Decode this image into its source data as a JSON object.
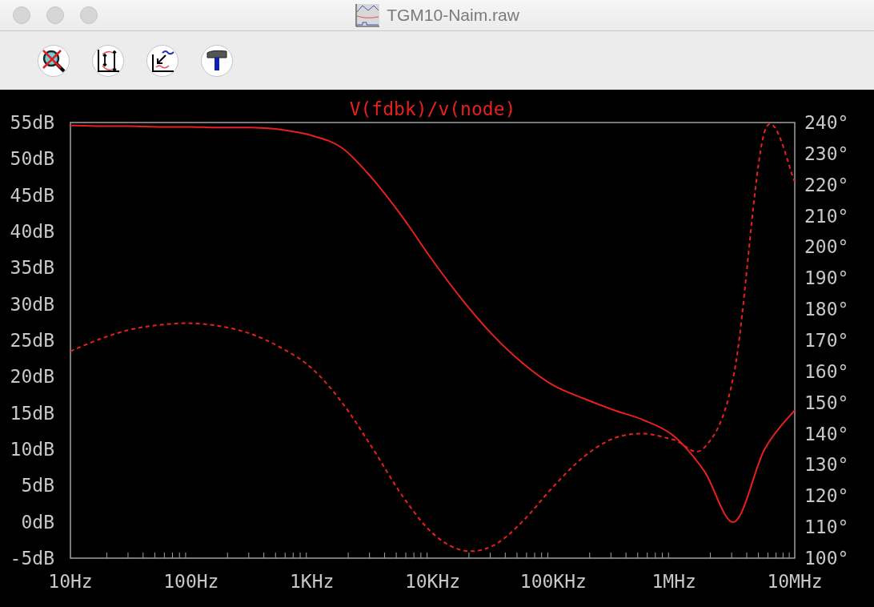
{
  "window": {
    "title": "TGM10-Naim.raw"
  },
  "toolbar": {
    "buttons": [
      {
        "kind": "zoom-cancel"
      },
      {
        "kind": "autorange"
      },
      {
        "kind": "back"
      },
      {
        "kind": "tools"
      }
    ]
  },
  "plot": {
    "chart_data": {
      "type": "line",
      "title": "V(fdbk)/v(node)",
      "categories": [
        "10Hz",
        null,
        null,
        null,
        "100Hz",
        null,
        null,
        null,
        "1KHz",
        null,
        null,
        null,
        "10KHz",
        null,
        null,
        null,
        "100KHz",
        null,
        null,
        null,
        "1MHz",
        null,
        null,
        null,
        "10MHz"
      ],
      "ylim": [
        -5,
        55
      ],
      "yticks": [
        {
          "value": 55,
          "label": "55dB"
        },
        {
          "value": 50,
          "label": "50dB"
        },
        {
          "value": 45,
          "label": "45dB"
        },
        {
          "value": 40,
          "label": "40dB"
        },
        {
          "value": 35,
          "label": "35dB"
        },
        {
          "value": 30,
          "label": "30dB"
        },
        {
          "value": 25,
          "label": "25dB"
        },
        {
          "value": 20,
          "label": "20dB"
        },
        {
          "value": 15,
          "label": "15dB"
        },
        {
          "value": 10,
          "label": "10dB"
        },
        {
          "value": 5,
          "label": "5dB"
        },
        {
          "value": 0,
          "label": "0dB"
        },
        {
          "value": -5,
          "label": "-5dB"
        }
      ],
      "y2lim": [
        100,
        240
      ],
      "y2ticks": [
        {
          "value": 240,
          "label": "240°"
        },
        {
          "value": 230,
          "label": "230°"
        },
        {
          "value": 220,
          "label": "220°"
        },
        {
          "value": 210,
          "label": "210°"
        },
        {
          "value": 200,
          "label": "200°"
        },
        {
          "value": 190,
          "label": "190°"
        },
        {
          "value": 180,
          "label": "180°"
        },
        {
          "value": 170,
          "label": "170°"
        },
        {
          "value": 160,
          "label": "160°"
        },
        {
          "value": 150,
          "label": "150°"
        },
        {
          "value": 140,
          "label": "140°"
        },
        {
          "value": 130,
          "label": "130°"
        },
        {
          "value": 120,
          "label": "120°"
        },
        {
          "value": 110,
          "label": "110°"
        },
        {
          "value": 100,
          "label": "100°"
        }
      ],
      "series": [
        {
          "color": "#e8201c",
          "line_style": "solid",
          "values": [
            54.6,
            54.5,
            54.5,
            54.4,
            54.4,
            54.3,
            54.3,
            54,
            53.2,
            51.5,
            47.3,
            42,
            36,
            30.5,
            25.7,
            21.8,
            18.8,
            17,
            15.4,
            14,
            11.8,
            7,
            0,
            10,
            15.4
          ]
        },
        {
          "color": "#e8201c",
          "axis": "y2",
          "line_style": "dashed",
          "values": [
            166.5,
            170.5,
            173.5,
            175,
            175.5,
            174.5,
            172,
            167.5,
            161,
            150,
            135.5,
            120,
            108,
            102.5,
            104,
            112,
            123,
            132.5,
            138.5,
            140,
            138,
            135.5,
            160,
            237,
            221
          ]
        }
      ]
    }
  }
}
